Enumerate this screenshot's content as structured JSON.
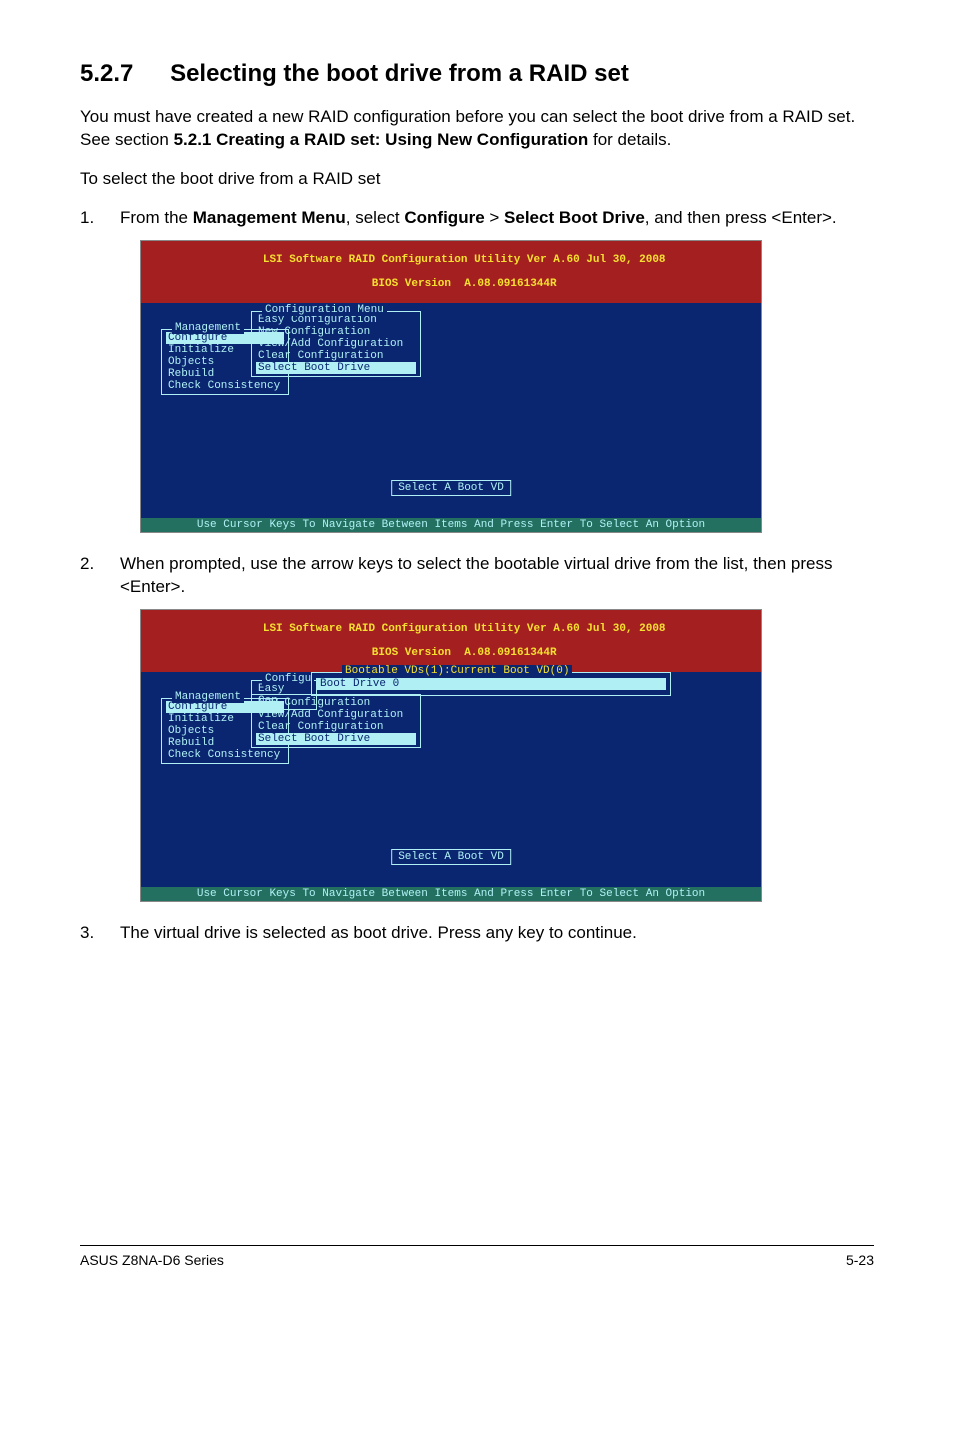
{
  "heading": {
    "number": "5.2.7",
    "title": "Selecting the boot drive from a RAID set"
  },
  "intro": {
    "p1_pre": "You must have created a new RAID configuration before you can select the boot drive from a RAID set. See section ",
    "p1_bold": "5.2.1 Creating a RAID set: Using New Configuration",
    "p1_post": " for details.",
    "p2": "To select the boot drive from a RAID set"
  },
  "steps": {
    "s1": {
      "num": "1.",
      "pre": "From the ",
      "b1": "Management Menu",
      "mid1": ", select ",
      "b2": "Configure",
      "mid2": " > ",
      "b3": "Select Boot Drive",
      "post": ", and then press <Enter>."
    },
    "s2": {
      "num": "2.",
      "text": "When prompted, use the arrow keys to select the bootable virtual drive from the list, then press <Enter>."
    },
    "s3": {
      "num": "3.",
      "text": "The virtual drive is selected as boot drive. Press any key to continue."
    }
  },
  "bios": {
    "title_line1": "LSI Software RAID Configuration Utility Ver A.60 Jul 30, 2008",
    "title_line2": "BIOS Version  A.08.09161344R",
    "mgmt_title": "Management",
    "mgmt_items": [
      "Configure",
      "Initialize",
      "Objects",
      "Rebuild",
      "Check Consistency"
    ],
    "cfg_title": "Configuration Menu",
    "cfg_items": [
      "Easy Configuration",
      "New Configuration",
      "View/Add Configuration",
      "Clear Configuration",
      "Select Boot Drive"
    ],
    "cfg_abbrev_title": "Configu",
    "cfg_abbrev_first": "Easy Con",
    "boot_title": "Bootable VDs(1):Current Boot VD(0)",
    "boot_item": "Boot Drive 0",
    "hint": "Select A Boot VD",
    "footer": "Use Cursor Keys To Navigate Between Items And Press Enter To Select An Option"
  },
  "page_footer": {
    "left": "ASUS Z8NA-D6 Series",
    "right": "5-23"
  }
}
